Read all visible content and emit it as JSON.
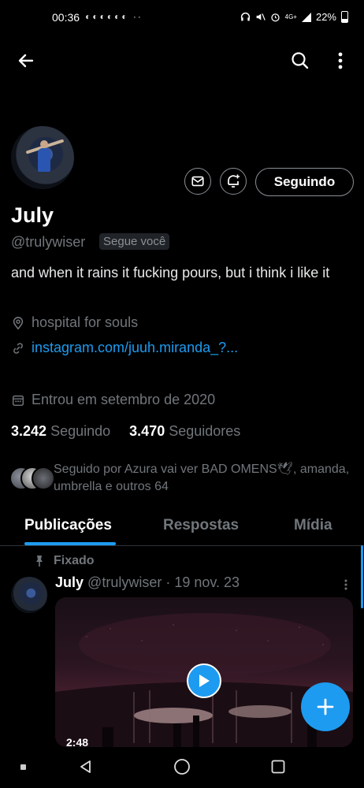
{
  "status_bar": {
    "time": "00:36",
    "notif_icons": "◐◐◐◐◐◐ ··",
    "network": "4G+",
    "battery": "22%"
  },
  "profile": {
    "name": "July",
    "handle": "@trulywiser",
    "follows_you": "Segue você",
    "follow_button": "Seguindo",
    "bio": "and when it rains it fucking pours, but i think i like it",
    "location": "hospital for souls",
    "website": "instagram.com/juuh.miranda_?...",
    "joined": "Entrou em setembro de 2020",
    "following_count": "3.242",
    "following_label": "Seguindo",
    "followers_count": "3.470",
    "followers_label": "Seguidores",
    "followed_by": "Seguido por Azura vai ver BAD OMENS🕊, amanda, umbrella e outros 64"
  },
  "tabs": [
    {
      "label": "Publicações",
      "active": true
    },
    {
      "label": "Respostas",
      "active": false
    },
    {
      "label": "Mídia",
      "active": false
    }
  ],
  "pinned_post": {
    "pinned_label": "Fixado",
    "author": "July",
    "handle": "@trulywiser",
    "date": "· 19 nov. 23",
    "video_time": "2:48"
  },
  "colors": {
    "accent": "#1d9bf0",
    "background": "#000000",
    "muted": "#71767b"
  }
}
